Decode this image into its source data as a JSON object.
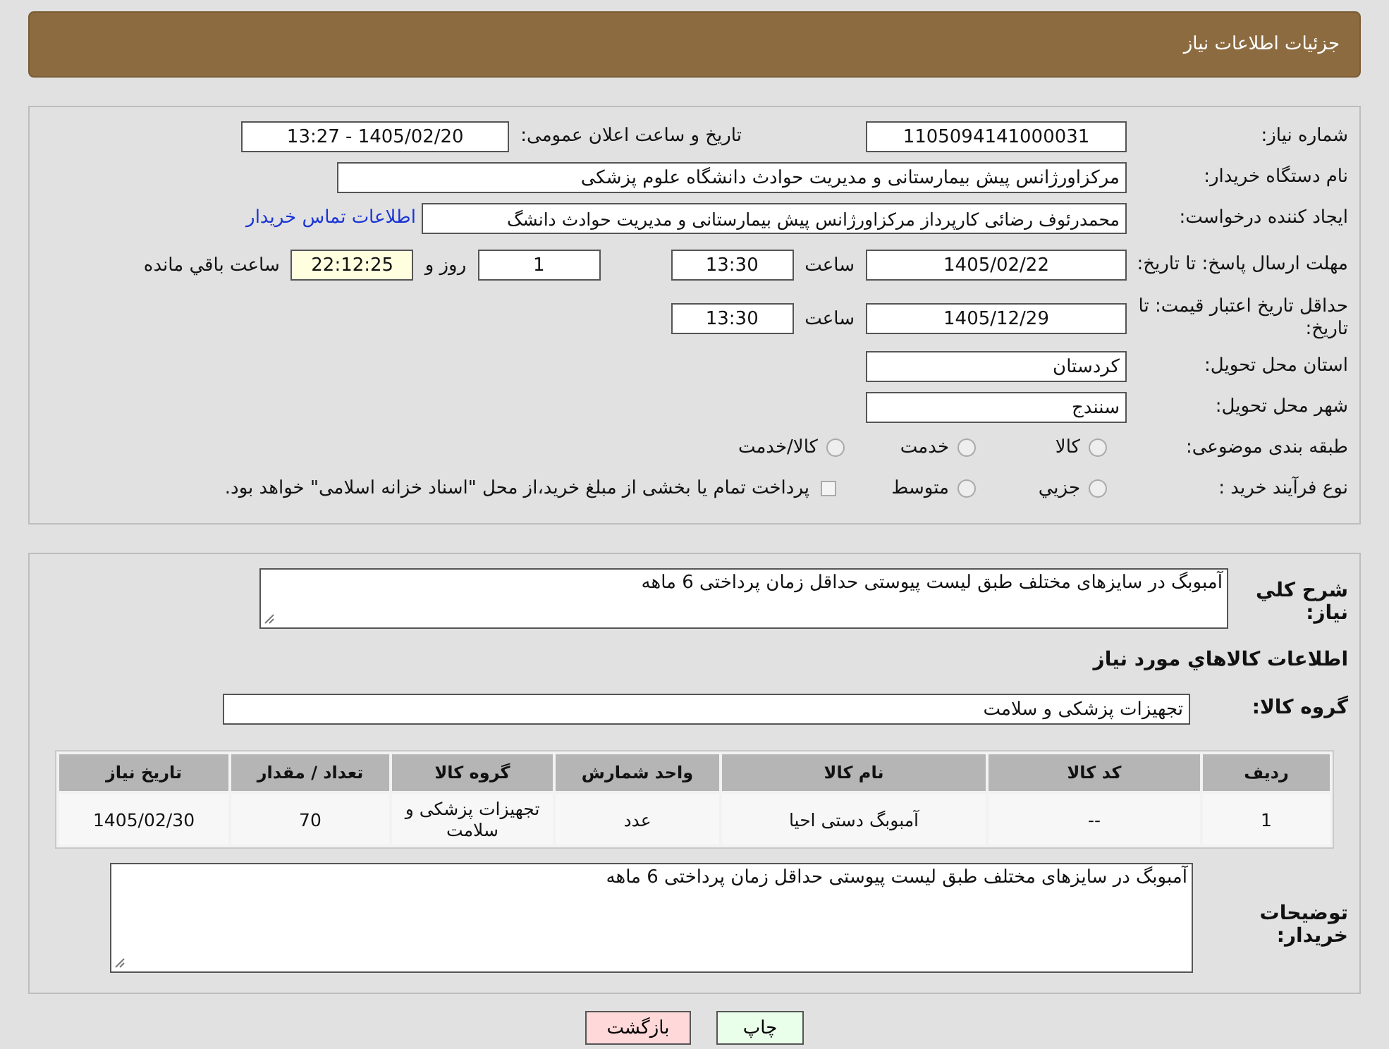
{
  "header": {
    "title": "جزئیات اطلاعات نیاز"
  },
  "need_number": {
    "label": "شماره نیاز:",
    "value": "1105094141000031"
  },
  "announce": {
    "label": "تاریخ و ساعت اعلان عمومی:",
    "value": "1405/02/20 - 13:27"
  },
  "buyer_org": {
    "label": "نام دستگاه خریدار:",
    "value": "مرکزاورژانس پیش بیمارستانی و مدیریت حوادث دانشگاه علوم پزشکی"
  },
  "requester": {
    "label": "ایجاد کننده درخواست:",
    "value": "محمدرئوف رضائی کارپرداز مرکزاورژانس پیش بیمارستانی و مدیریت حوادث دانشگ",
    "link": "اطلاعات تماس خریدار"
  },
  "deadline": {
    "label": "مهلت ارسال پاسخ: تا تاریخ:",
    "date": "1405/02/22",
    "time_label": "ساعت",
    "time": "13:30",
    "days": "1",
    "days_label": "روز و",
    "remaining": "22:12:25",
    "remaining_label": "ساعت باقي مانده"
  },
  "validity": {
    "label": "حداقل تاریخ اعتبار قیمت: تا تاریخ:",
    "date": "1405/12/29",
    "time_label": "ساعت",
    "time": "13:30"
  },
  "province": {
    "label": "استان محل تحویل:",
    "value": "کردستان"
  },
  "city": {
    "label": "شهر محل تحویل:",
    "value": "سنندج"
  },
  "category": {
    "label": "طبقه بندی موضوعی:",
    "options": [
      {
        "label": "کالا",
        "selected": false
      },
      {
        "label": "خدمت",
        "selected": false
      },
      {
        "label": "کالا/خدمت",
        "selected": false
      }
    ]
  },
  "process": {
    "label": "نوع فرآیند خرید :",
    "options": [
      {
        "label": "جزيي",
        "selected": false
      },
      {
        "label": "متوسط",
        "selected": false
      }
    ],
    "note": "پرداخت تمام یا بخشی از مبلغ خرید،از محل \"اسناد خزانه اسلامی\" خواهد بود.",
    "note_checked": false
  },
  "summary": {
    "label": "شرح کلي نياز:",
    "value": "آمبوبگ در سایزهای مختلف طبق لیست پیوستی حداقل زمان پرداختی 6 ماهه"
  },
  "goods_heading": "اطلاعات کالاهاي مورد نياز",
  "goods_group": {
    "label": "گروه کالا:",
    "value": "تجهیزات پزشکی و سلامت"
  },
  "table": {
    "columns": [
      "رديف",
      "کد کالا",
      "نام کالا",
      "واحد شمارش",
      "گروه کالا",
      "تعداد / مقدار",
      "تاریخ نیاز"
    ],
    "rows": [
      [
        "1",
        "--",
        "آمبوبگ دستی احیا",
        "عدد",
        "تجهیزات پزشکی و سلامت",
        "70",
        "1405/02/30"
      ]
    ]
  },
  "buyer_notes": {
    "label": "توضیحات خریدار:",
    "value": "آمبوبگ در سایزهای مختلف طبق لیست پیوستی حداقل زمان پرداختی 6 ماهه"
  },
  "buttons": [
    {
      "label": "چاپ",
      "kind": "print"
    },
    {
      "label": "بازگشت",
      "kind": "back"
    }
  ]
}
